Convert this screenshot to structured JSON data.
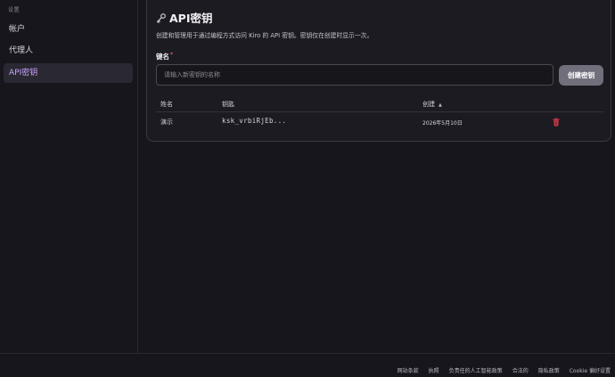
{
  "sidebar": {
    "section_label": "设置",
    "items": [
      {
        "label": "帐户"
      },
      {
        "label": "代理人"
      },
      {
        "label": "API密钥"
      }
    ]
  },
  "card": {
    "title": "API密钥",
    "description": "创建和管理用于通过编程方式访问 Kiro 的 API 密钥。密钥仅在创建时显示一次。",
    "field_label": "键名",
    "required_mark": "*",
    "input": {
      "value": "",
      "placeholder": "请输入新密钥的名称"
    },
    "create_button": "创建密钥"
  },
  "table": {
    "headers": [
      "姓名",
      "钥匙",
      "创建"
    ],
    "sort_indicator": "▲",
    "rows": [
      {
        "name": "演示",
        "key": "ksk_vrbiRjEb...",
        "created": "2026年5月10日"
      }
    ]
  },
  "footer": {
    "links": [
      "网站条款",
      "执照",
      "负责任的人工智能政策",
      "合法的",
      "隐私政策",
      "Cookie 偏好设置"
    ]
  },
  "colors": {
    "background": "#17161c",
    "active_nav_text": "#c9a7ff",
    "delete_icon": "#e0384a",
    "button_bg": "#726f7c"
  },
  "icons": {
    "title_icon": "key-icon",
    "row_action": "trash-icon"
  }
}
